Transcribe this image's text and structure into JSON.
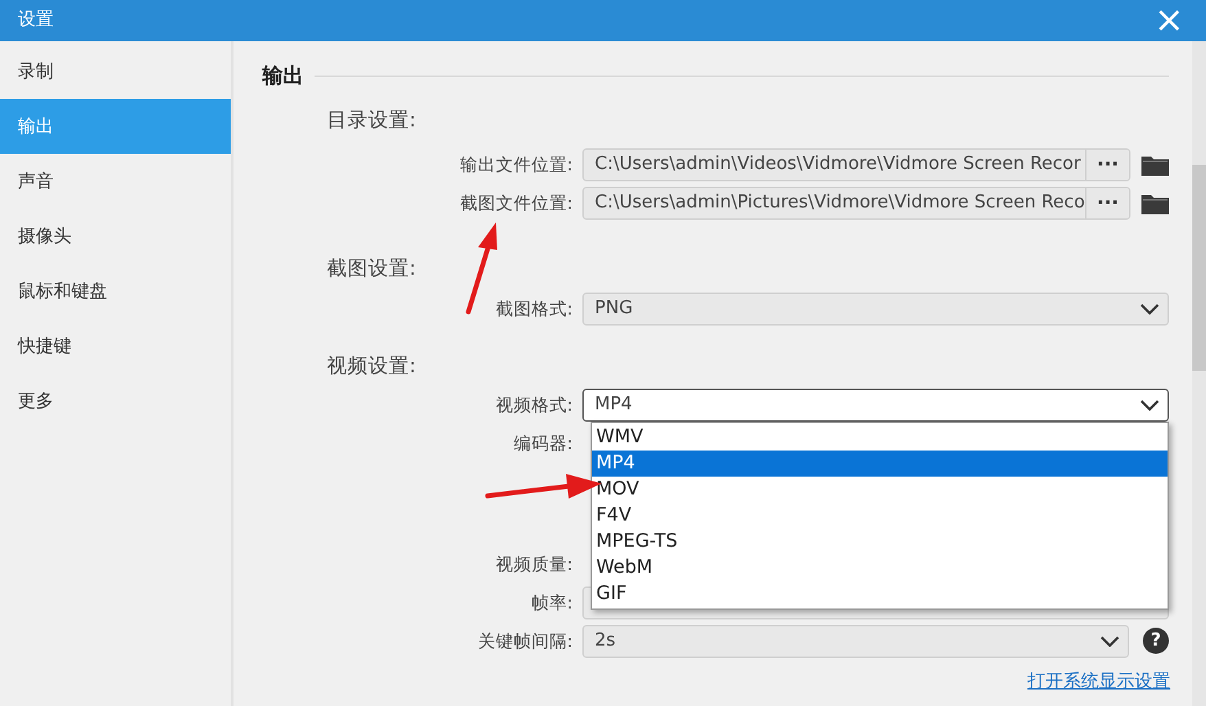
{
  "window": {
    "title": "设置",
    "close": "×"
  },
  "sidebar": {
    "items": [
      {
        "label": "录制",
        "selected": false
      },
      {
        "label": "输出",
        "selected": true
      },
      {
        "label": "声音",
        "selected": false
      },
      {
        "label": "摄像头",
        "selected": false
      },
      {
        "label": "鼠标和键盘",
        "selected": false
      },
      {
        "label": "快捷键",
        "selected": false
      },
      {
        "label": "更多",
        "selected": false
      }
    ]
  },
  "section": {
    "title": "输出"
  },
  "groups": [
    {
      "heading": "目录设置:",
      "rows": [
        {
          "kind": "path",
          "label": "输出文件位置:",
          "value": "C:\\Users\\admin\\Videos\\Vidmore\\Vidmore Screen Recor",
          "button": "···"
        },
        {
          "kind": "path",
          "label": "截图文件位置:",
          "value": "C:\\Users\\admin\\Pictures\\Vidmore\\Vidmore Screen Reco",
          "button": "···"
        }
      ]
    },
    {
      "heading": "截图设置:",
      "rows": [
        {
          "kind": "select",
          "label": "截图格式:",
          "value": "PNG"
        }
      ]
    },
    {
      "heading": "视频设置:",
      "rows": [
        {
          "kind": "select",
          "label": "视频格式:",
          "value": "MP4",
          "expanded": true,
          "options": [
            {
              "label": "WMV",
              "selected": false
            },
            {
              "label": "MP4",
              "selected": true
            },
            {
              "label": "MOV",
              "selected": false
            },
            {
              "label": "F4V",
              "selected": false
            },
            {
              "label": "MPEG-TS",
              "selected": false
            },
            {
              "label": "WebM",
              "selected": false
            },
            {
              "label": "GIF",
              "selected": false
            }
          ]
        },
        {
          "kind": "covered",
          "label": "编码器:"
        },
        {
          "kind": "label",
          "label": "视频质量:"
        },
        {
          "kind": "select",
          "label": "帧率:",
          "value": ""
        },
        {
          "kind": "select",
          "label": "关键帧间隔:",
          "value": "2s",
          "help": "?"
        }
      ]
    }
  ],
  "link": "打开系统显示设置"
}
